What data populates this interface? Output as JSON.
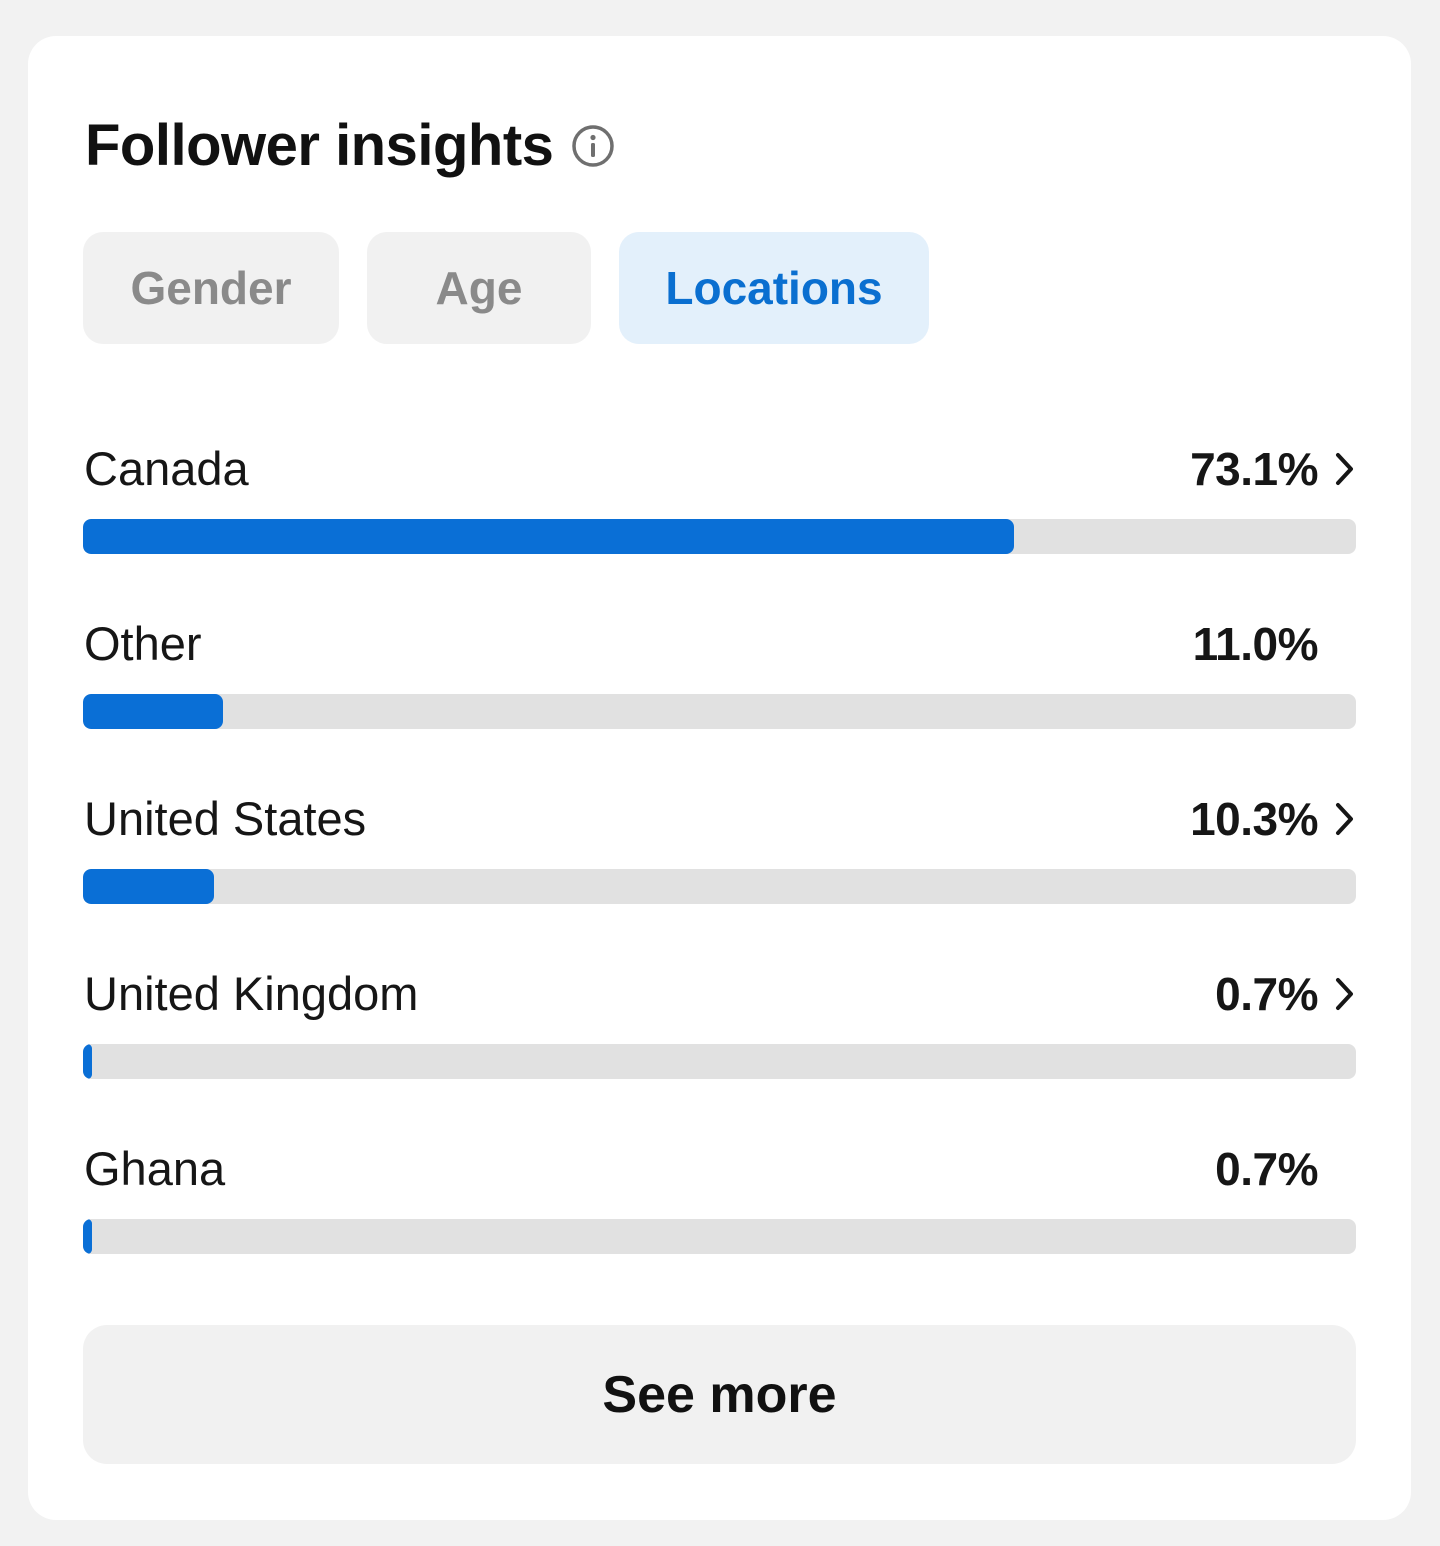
{
  "card": {
    "title": "Follower insights",
    "info_icon": "info-circle-icon"
  },
  "tabs": [
    {
      "label": "Gender",
      "selected": false
    },
    {
      "label": "Age",
      "selected": false
    },
    {
      "label": "Locations",
      "selected": true
    }
  ],
  "colors": {
    "accent": "#0a6fd6",
    "selected_tab_bg": "#e3f0fb",
    "track": "#e1e1e1"
  },
  "locations": [
    {
      "name": "Canada",
      "percent_label": "73.1%",
      "fraction": 0.731,
      "has_chevron": true
    },
    {
      "name": "Other",
      "percent_label": "11.0%",
      "fraction": 0.11,
      "has_chevron": false
    },
    {
      "name": "United States",
      "percent_label": "10.3%",
      "fraction": 0.103,
      "has_chevron": true
    },
    {
      "name": "United Kingdom",
      "percent_label": "0.7%",
      "fraction": 0.007,
      "has_chevron": true
    },
    {
      "name": "Ghana",
      "percent_label": "0.7%",
      "fraction": 0.007,
      "has_chevron": false
    }
  ],
  "footer": {
    "see_more_label": "See more"
  }
}
